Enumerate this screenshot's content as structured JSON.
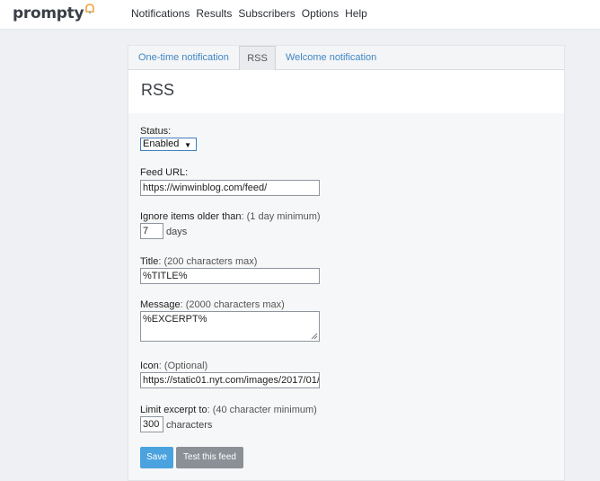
{
  "app": {
    "logo": "prompty"
  },
  "nav": {
    "items": [
      "Notifications",
      "Results",
      "Subscribers",
      "Options",
      "Help"
    ]
  },
  "tabs": [
    {
      "label": "One-time notification",
      "active": false
    },
    {
      "label": "RSS",
      "active": true
    },
    {
      "label": "Welcome notification",
      "active": false
    }
  ],
  "page": {
    "title": "RSS"
  },
  "form": {
    "status": {
      "label": "Status:",
      "value": "Enabled"
    },
    "feed_url": {
      "label": "Feed URL:",
      "value": "https://winwinblog.com/feed/"
    },
    "ignore": {
      "label": "Ignore items older than",
      "hint": ": (1 day minimum)",
      "value": "7",
      "unit": "days"
    },
    "title": {
      "label": "Title",
      "hint": ": (200 characters max)",
      "value": "%TITLE%"
    },
    "message": {
      "label": "Message",
      "hint": ": (2000 characters max)",
      "value": "%EXCERPT%"
    },
    "icon": {
      "label": "Icon",
      "hint": ": (Optional)",
      "value": "https://static01.nyt.com/images/2017/01/"
    },
    "limit": {
      "label": "Limit excerpt to",
      "hint": ": (40 character minimum)",
      "value": "300",
      "unit": "characters"
    }
  },
  "buttons": {
    "save": "Save",
    "test": "Test this feed"
  },
  "colors": {
    "accent": "#4aa3df",
    "link": "#3f87c4",
    "secondary_button": "#8a9096"
  }
}
